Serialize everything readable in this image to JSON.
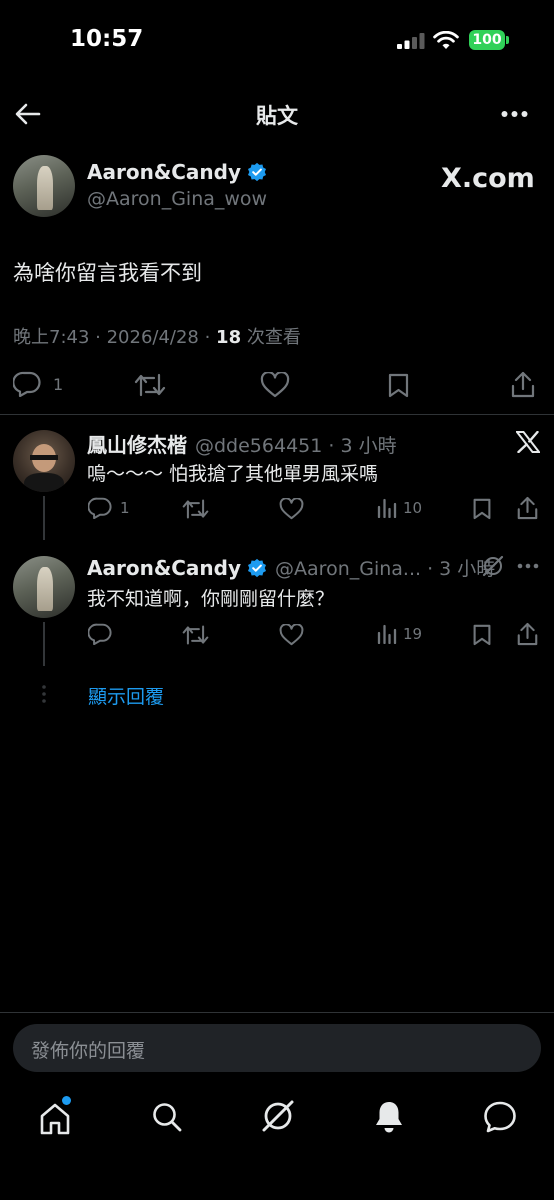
{
  "status_bar": {
    "time": "10:57",
    "battery": "100"
  },
  "header": {
    "title": "貼文"
  },
  "post": {
    "author_name": "Aaron&Candy",
    "author_handle": "@Aaron_Gina_wow",
    "badge": "X.com",
    "text": "為啥你留言我看不到",
    "timestamp": "晚上7:43 · 2026/4/28 · ",
    "views": "18",
    "views_label": " 次查看",
    "reply_count": "1"
  },
  "replies": [
    {
      "author_name": "鳳山修杰楷",
      "handle_time": "@dde564451 · 3 小時",
      "text": "嗚～～～ 怕我搶了其他單男風采嗎",
      "reply_count": "1",
      "view_count": "10"
    },
    {
      "author_name": "Aaron&Candy",
      "handle_time": "@Aaron_Gina... · 3 小時",
      "text": "我不知道啊，你剛剛留什麼？",
      "view_count": "19"
    }
  ],
  "show_replies": "顯示回覆",
  "composer": {
    "placeholder": "發佈你的回覆"
  },
  "colors": {
    "accent": "#1d9bf0",
    "battery": "#30d158",
    "muted": "#71767b"
  },
  "icons": [
    "back-arrow-icon",
    "more-icon",
    "reply-icon",
    "repost-icon",
    "like-icon",
    "bookmark-icon",
    "share-icon",
    "views-icon",
    "grok-icon",
    "x-logo-icon",
    "home-icon",
    "search-icon",
    "bell-icon",
    "messages-icon"
  ]
}
